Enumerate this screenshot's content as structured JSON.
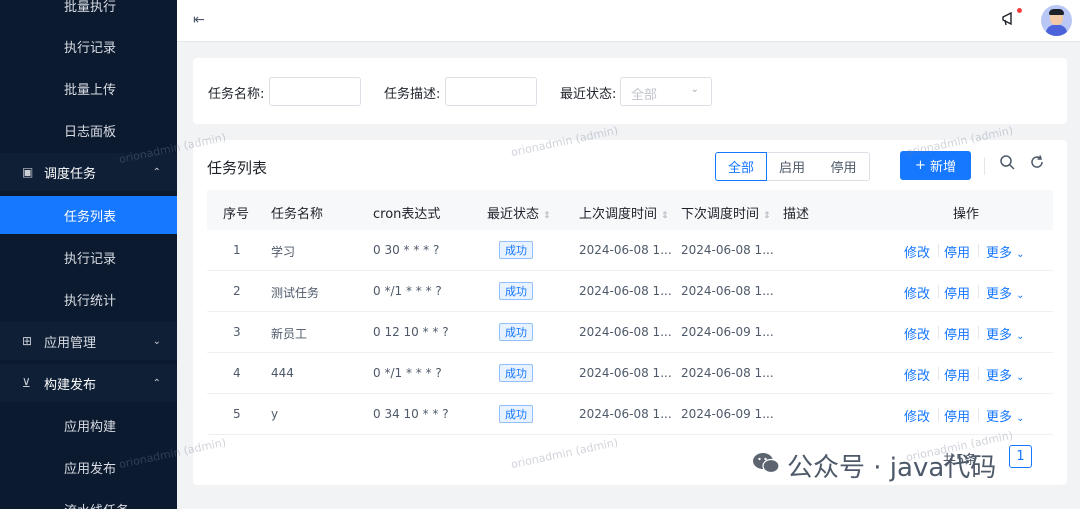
{
  "sidebar": {
    "items": [
      {
        "label": "批量执行"
      },
      {
        "label": "执行记录"
      },
      {
        "label": "批量上传"
      },
      {
        "label": "日志面板"
      },
      {
        "label": "调度任务"
      },
      {
        "label": "任务列表"
      },
      {
        "label": "执行记录"
      },
      {
        "label": "执行统计"
      },
      {
        "label": "应用管理"
      },
      {
        "label": "构建发布"
      },
      {
        "label": "应用构建"
      },
      {
        "label": "应用发布"
      },
      {
        "label": "流水线任务"
      }
    ]
  },
  "search": {
    "name_label": "任务名称:",
    "desc_label": "任务描述:",
    "status_label": "最近状态:",
    "status_selected": "全部"
  },
  "table_card": {
    "title": "任务列表",
    "filters": [
      "全部",
      "启用",
      "停用"
    ],
    "new_button": "新增",
    "new_icon": "+",
    "columns": [
      "序号",
      "任务名称",
      "cron表达式",
      "最近状态",
      "上次调度时间",
      "下次调度时间",
      "描述",
      "操作"
    ],
    "rows": [
      {
        "index": "1",
        "name": "学习",
        "cron": "0 30 * * * ?",
        "status": "成功",
        "last": "2024-06-08 1...",
        "next": "2024-06-08 1...",
        "desc": ""
      },
      {
        "index": "2",
        "name": "测试任务",
        "cron": "0 */1 * * * ?",
        "status": "成功",
        "last": "2024-06-08 1...",
        "next": "2024-06-08 1...",
        "desc": ""
      },
      {
        "index": "3",
        "name": "新员工",
        "cron": "0 12 10 * * ?",
        "status": "成功",
        "last": "2024-06-08 1...",
        "next": "2024-06-09 1...",
        "desc": ""
      },
      {
        "index": "4",
        "name": "444",
        "cron": "0 */1 * * * ?",
        "status": "成功",
        "last": "2024-06-08 1...",
        "next": "2024-06-08 1...",
        "desc": ""
      },
      {
        "index": "5",
        "name": "y",
        "cron": "0 34 10 * * ?",
        "status": "成功",
        "last": "2024-06-08 1...",
        "next": "2024-06-09 1...",
        "desc": ""
      }
    ],
    "actions": {
      "edit": "修改",
      "disable": "停用",
      "more": "更多"
    },
    "pager": {
      "total": "共5条",
      "page": "1"
    }
  },
  "watermark": "orionadmin (admin)",
  "overlay": {
    "wechat": "公众号 · java代码"
  },
  "icons": {
    "menu": "menu-fold-icon",
    "notice": "megaphone-icon",
    "search": "search-icon",
    "refresh": "refresh-icon"
  },
  "colors": {
    "primary": "#1677ff",
    "sidebar": "#0b1a2f"
  }
}
